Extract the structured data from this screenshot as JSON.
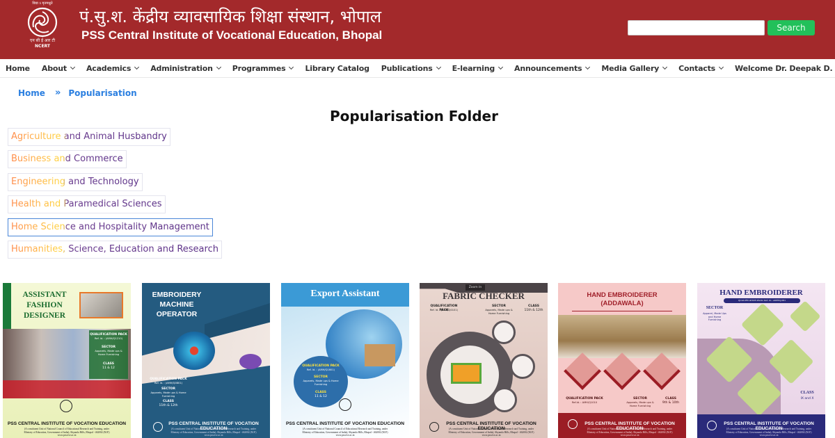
{
  "header": {
    "logo": {
      "motto": "विद्या ऽ मृतमश्नुते",
      "name_hi": "एन सी ई आर टी",
      "name_en": "NCERT"
    },
    "title_hindi": "पं.सु.श. केंद्रीय व्यावसायिक शिक्षा संस्थान, भोपाल",
    "title_english": "PSS Central Institute of Vocational Education, Bhopal",
    "search": {
      "value": "",
      "placeholder": "",
      "button_label": "Search"
    }
  },
  "nav": {
    "items": [
      {
        "label": "Home",
        "dropdown": false
      },
      {
        "label": "About",
        "dropdown": true
      },
      {
        "label": "Academics",
        "dropdown": true
      },
      {
        "label": "Administration",
        "dropdown": true
      },
      {
        "label": "Programmes",
        "dropdown": true
      },
      {
        "label": "Library Catalog",
        "dropdown": false
      },
      {
        "label": "Publications",
        "dropdown": true
      },
      {
        "label": "E-learning",
        "dropdown": true
      },
      {
        "label": "Announcements",
        "dropdown": true
      },
      {
        "label": "Media Gallery",
        "dropdown": true
      },
      {
        "label": "Contacts",
        "dropdown": true
      },
      {
        "label": "Welcome Dr. Deepak D. Shudhalwar",
        "dropdown": true
      }
    ]
  },
  "breadcrumb": {
    "home": "Home",
    "separator": "»",
    "current": "Popularisation"
  },
  "page_title": "Popularisation Folder",
  "folders": [
    {
      "label": "Agriculture and Animal Husbandry",
      "active": false
    },
    {
      "label": "Business and Commerce",
      "active": false
    },
    {
      "label": "Engineering and Technology",
      "active": false
    },
    {
      "label": "Health and Paramedical Sciences",
      "active": false
    },
    {
      "label": "Home Science and Hospitality Management",
      "active": true
    },
    {
      "label": "Humanities, Science, Education and Research",
      "active": false
    }
  ],
  "covers": [
    {
      "title": "ASSISTANT FASHION DESIGNER",
      "qp": "QUALIFICATION PACK",
      "ref": "Ref. Id. : (AMH/Q1210)",
      "sector_label": "SECTOR",
      "sector": "Apparels, Made ups & Home Furnishing",
      "class_label": "CLASS",
      "class": "11 & 12"
    },
    {
      "title": "EMBROIDERY MACHINE OPERATOR",
      "qp": "QUALIFICATION PACK",
      "ref": "Ref. Id. : (AMH/Q0801)",
      "sector_label": "SECTOR",
      "sector": "Apparels, Made ups & Home Furnishing",
      "class_label": "CLASS",
      "class": "11th & 12th"
    },
    {
      "title": "Export Assistant",
      "qp": "QUALIFICATION PACK",
      "ref": "Ref. Id. : (AMH/Q1601)",
      "sector_label": "SECTOR",
      "sector": "Apparels, Made ups & Home Furnishing",
      "class_label": "CLASS",
      "class": "11 & 12"
    },
    {
      "title": "FABRIC CHECKER",
      "badge": "Zoom In",
      "qp": "QUALIFICATION PACK",
      "ref": "Ref. Id. : (AMH/Q0101)",
      "sector_label": "SECTOR",
      "sector": "Apparels, Made ups & Home Furnishing",
      "class_label": "CLASS",
      "class": "11th & 12th"
    },
    {
      "title": "HAND EMBROIDERER (ADDAWALA)",
      "qp": "QUALIFICATION PACK",
      "ref": "Ref.Id. : AMH/Q1010",
      "sector_label": "SECTOR",
      "sector": "Apparels, Made ups & Home Furnishing",
      "class_label": "CLASS",
      "class": "9th & 10th"
    },
    {
      "title": "HAND EMBROIDERER",
      "qp": "QUALIFICATION PACK: Ref. Id. : AMH/Q1001",
      "sector_label": "SECTOR",
      "sector": "Apparel, Made Ups and Home Furnishing",
      "class_label": "CLASS",
      "class": "IX and X"
    }
  ],
  "cover_footer": {
    "institute": "PSS CENTRAL INSTITUTE OF VOCATION EDUCATION",
    "line1": "(A constituent Unit of National Council of Educational Research and Training, under",
    "line2": "Ministry of Education, Government of India), Shyamla Hills, Bhopal - 462002 (M.P.)",
    "website": "www.psscive.ac.in"
  },
  "colors": {
    "header_bg": "#a3292b",
    "search_button": "#22c05a",
    "link_blue": "#2b7fe0",
    "folder_gradient_start": "#ff8a4a",
    "folder_gradient_mid": "#ffd640",
    "folder_gradient_end": "#5a2f87",
    "active_border": "#4a86d8"
  }
}
